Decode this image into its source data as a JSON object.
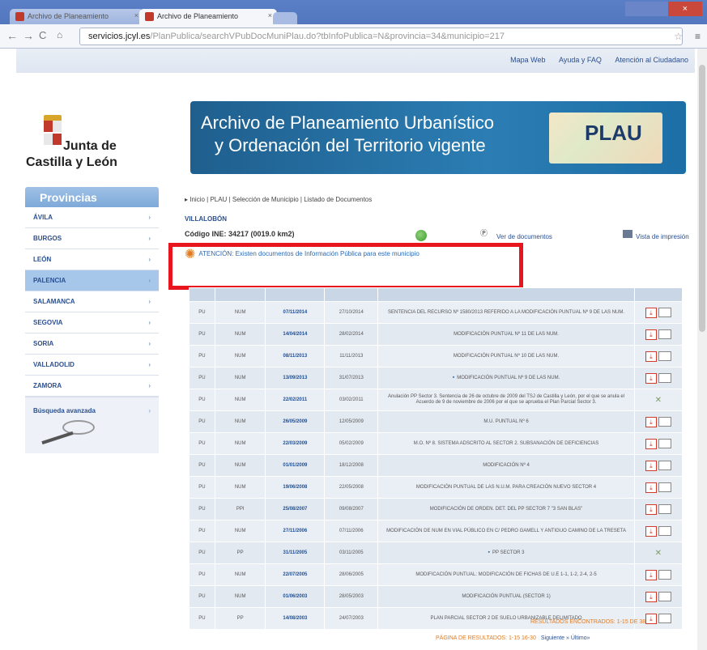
{
  "browser": {
    "tabs": [
      {
        "label": "Archivo de Planeamiento",
        "active": false
      },
      {
        "label": "Archivo de Planeamiento",
        "active": true
      }
    ],
    "url_host": "servicios.jcyl.es",
    "url_path": "/PlanPublica/searchVPubDocMuniPlau.do?tbInfoPublica=N&provincia=34&municipio=217"
  },
  "top_links": [
    "Mapa Web",
    "Ayuda y FAQ",
    "Atención al Ciudadano"
  ],
  "logo": {
    "line1": "Junta de",
    "line2": "Castilla y León"
  },
  "banner": {
    "line1": "Archivo de Planeamiento Urbanístico",
    "line2": "y Ordenación del Territorio vigente",
    "brand": "PLAU"
  },
  "sidebar": {
    "title": "Provincias",
    "items": [
      {
        "label": "ÁVILA",
        "active": false
      },
      {
        "label": "BURGOS",
        "active": false
      },
      {
        "label": "LEÓN",
        "active": false
      },
      {
        "label": "PALENCIA",
        "active": true
      },
      {
        "label": "SALAMANCA",
        "active": false
      },
      {
        "label": "SEGOVIA",
        "active": false
      },
      {
        "label": "SORIA",
        "active": false
      },
      {
        "label": "VALLADOLID",
        "active": false
      },
      {
        "label": "ZAMORA",
        "active": false
      }
    ],
    "search_label": "Búsqueda avanzada"
  },
  "main": {
    "breadcrumb": "▸ Inicio | PLAU | Selección de Municipio | Listado de Documentos",
    "town": "VILLALOBÓN",
    "ine": "Código INE: 34217 (0019.0 km2)",
    "action_pdf": "Ver de documentos",
    "action_print": "Vista de impresión",
    "attention": "ATENCIÓN: Existen documentos de Información Pública para este municipio"
  },
  "rows": [
    {
      "a": "PU",
      "b": "NUM",
      "d1": "07/11/2014",
      "d2": "27/10/2014",
      "desc": "SENTENCIA DEL RECURSO Nº 1580/2013 REFERIDO A LA MODIFICACIÓN PUNTUAL Nº 9 DE LAS NUM.",
      "icons": "pdf"
    },
    {
      "a": "PU",
      "b": "NUM",
      "d1": "14/04/2014",
      "d2": "28/02/2014",
      "desc": "MODIFICACIÓN PUNTUAL Nº 11 DE LAS NUM.",
      "icons": "pdf"
    },
    {
      "a": "PU",
      "b": "NUM",
      "d1": "08/11/2013",
      "d2": "11/11/2013",
      "desc": "MODIFICACIÓN PUNTUAL Nº 10 DE LAS NUM.",
      "icons": "pdf"
    },
    {
      "a": "PU",
      "b": "NUM",
      "d1": "13/09/2013",
      "d2": "31/07/2013",
      "desc": "MODIFICACIÓN PUNTUAL Nº 9 DE LAS NUM.",
      "icons": "pdf",
      "mark": true
    },
    {
      "a": "PU",
      "b": "NUM",
      "d1": "22/02/2011",
      "d2": "03/02/2011",
      "desc": "Anulación PP Sector 3. Sentencia de 26 de octubre de 2009 del TSJ de Castilla y León, por el que se anula el Acuerdo de 9 de noviembre de 2006 por el que se aprueba el Plan Parcial Sector 3.",
      "icons": "x"
    },
    {
      "a": "PU",
      "b": "NUM",
      "d1": "26/05/2009",
      "d2": "12/05/2009",
      "desc": "M.U. PUNTUAL Nº 6",
      "icons": "pdf"
    },
    {
      "a": "PU",
      "b": "NUM",
      "d1": "22/03/2009",
      "d2": "05/02/2009",
      "desc": "M.O. Nº 8. SISTEMA ADSCRITO AL SECTOR 2. SUBSANACIÓN DE DEFICIENCIAS",
      "icons": "pdf"
    },
    {
      "a": "PU",
      "b": "NUM",
      "d1": "01/01/2009",
      "d2": "18/12/2008",
      "desc": "MODIFICACIÓN Nº 4",
      "icons": "pdf"
    },
    {
      "a": "PU",
      "b": "NUM",
      "d1": "19/06/2008",
      "d2": "22/05/2008",
      "desc": "MODIFICACIÓN PUNTUAL DE LAS N.U.M. PARA CREACIÓN NUEVO SECTOR 4",
      "icons": "pdf"
    },
    {
      "a": "PU",
      "b": "PPI",
      "d1": "25/08/2007",
      "d2": "09/08/2007",
      "desc": "MODIFICACIÓN DE ORDEN. DET. DEL PP SECTOR 7 \"3 SAN BLAS\"",
      "icons": "pdf"
    },
    {
      "a": "PU",
      "b": "NUM",
      "d1": "27/11/2006",
      "d2": "07/11/2006",
      "desc": "MODIFICACIÓN DE NUM EN VIAL PÚBLICO EN C/ PEDRO GAMELL Y ANTIGUO CAMINO DE LA TRESETA",
      "icons": "pdf"
    },
    {
      "a": "PU",
      "b": "PP",
      "d1": "31/11/2005",
      "d2": "03/11/2005",
      "desc": "PP SECTOR 3",
      "icons": "x",
      "mark": true
    },
    {
      "a": "PU",
      "b": "NUM",
      "d1": "22/07/2005",
      "d2": "28/06/2005",
      "desc": "MODIFICACIÓN PUNTUAL: MODIFICACIÓN DE FICHAS DE U.E 1-1, 1-2, 2-4, 2-5",
      "icons": "pdf"
    },
    {
      "a": "PU",
      "b": "NUM",
      "d1": "01/06/2003",
      "d2": "28/05/2003",
      "desc": "MODIFICACIÓN PUNTUAL (SECTOR 1)",
      "icons": "pdf"
    },
    {
      "a": "PU",
      "b": "PP",
      "d1": "14/08/2003",
      "d2": "24/07/2003",
      "desc": "PLAN PARCIAL SECTOR 2 DE SUELO URBANIZABLE DELIMITADO",
      "icons": "pdf"
    }
  ],
  "footer": {
    "results": "RESULTADOS ENCONTRADOS: 1-15 DE 38",
    "pages": "PÁGINA DE RESULTADOS: 1-15 16-30",
    "next": "Siguiente »  Último»"
  }
}
